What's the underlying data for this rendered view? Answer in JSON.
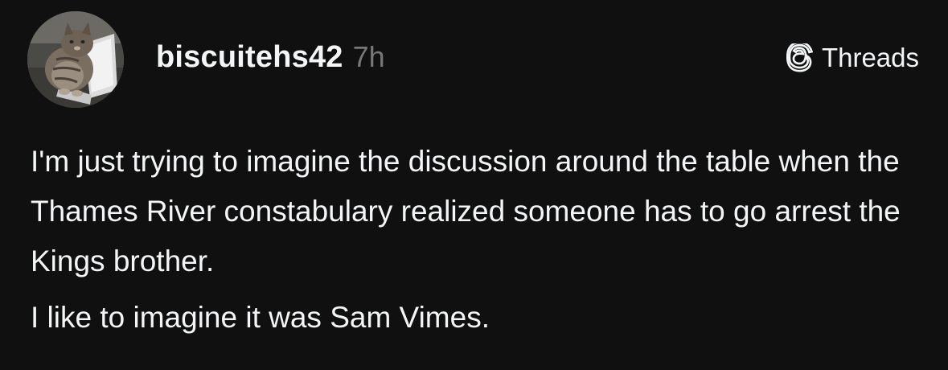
{
  "post": {
    "avatar_icon": "cat-avatar",
    "username": "biscuitehs42",
    "timestamp": "7h",
    "brand": {
      "icon": "threads-logo-icon",
      "label": "Threads"
    },
    "paragraphs": [
      "I'm just trying to imagine the discussion around the table when the Thames River constabulary realized someone has to go arrest the Kings brother.",
      "I like to imagine it was Sam Vimes."
    ]
  },
  "colors": {
    "background": "#101010",
    "text": "#f3f5f7",
    "timestamp": "#777777"
  }
}
